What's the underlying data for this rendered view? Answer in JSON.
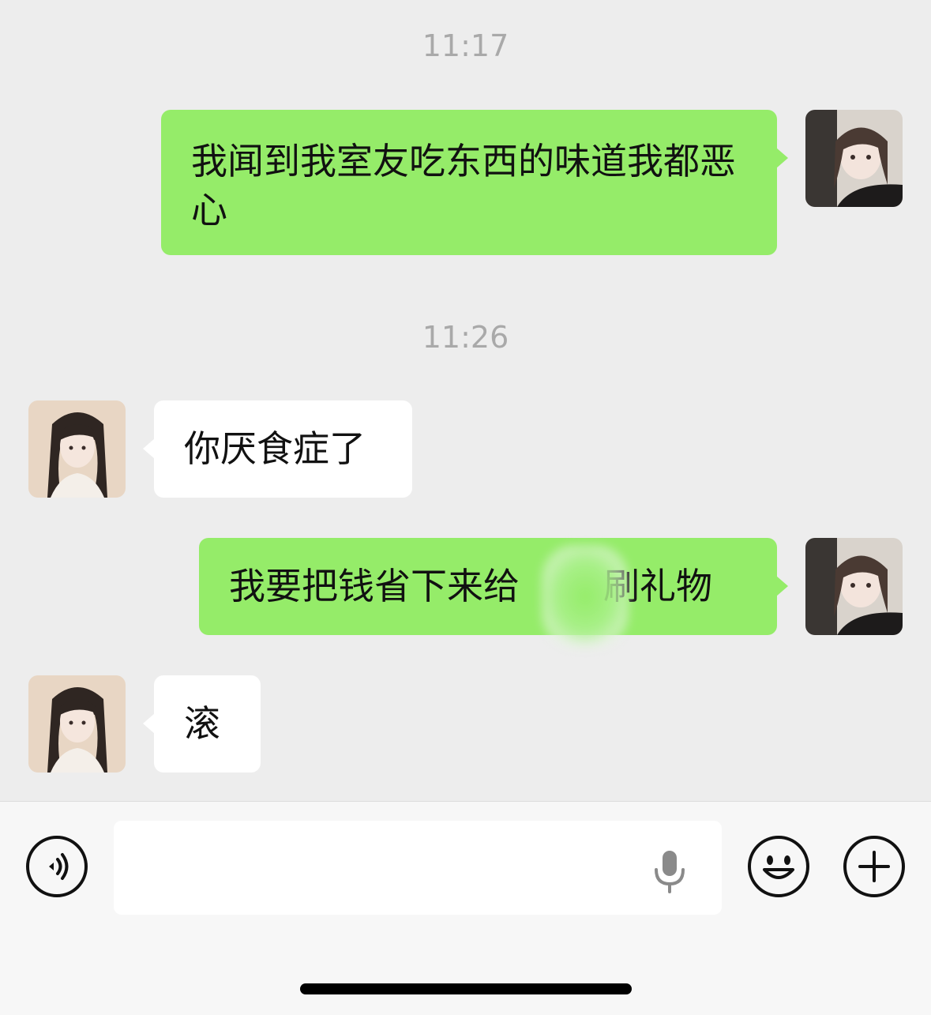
{
  "chat": {
    "timestamps": [
      "11:17",
      "11:26"
    ],
    "messages": [
      {
        "sender": "me",
        "text": "我闻到我室友吃东西的味道我都恶心"
      },
      {
        "sender": "other",
        "text": "你厌食症了"
      },
      {
        "sender": "me",
        "text": "我要把钱省下来给",
        "text_after_blur": "刷礼物"
      },
      {
        "sender": "other",
        "text": "滚"
      }
    ]
  },
  "input_bar": {
    "value": "",
    "icons": {
      "voice": "voice-mode-icon",
      "mic": "microphone-icon",
      "emoji": "emoji-icon",
      "plus": "plus-icon"
    }
  },
  "colors": {
    "sent_bubble": "#95ec69",
    "received_bubble": "#ffffff",
    "background": "#ededed",
    "timestamp": "#a9a9a9"
  }
}
